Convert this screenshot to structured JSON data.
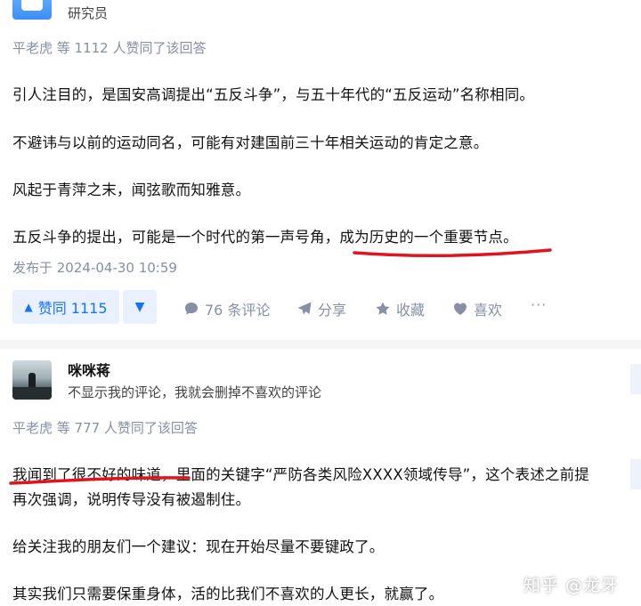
{
  "answer1": {
    "author_headline": "研究员",
    "voters": "平老虎 等 1112 人赞同了该回答",
    "paragraphs": [
      "引人注目的，是国安高调提出“五反斗争”，与五十年代的“五反运动”名称相同。",
      "不避讳与以前的运动同名，可能有对建国前三十年相关运动的肯定之意。",
      "风起于青萍之末，闻弦歌而知雅意。",
      "五反斗争的提出，可能是一个时代的第一声号角，成为历史的一个重要节点。"
    ],
    "published": "发布于 2024-04-30 10:59",
    "actions": {
      "vote_up": "赞同 1115",
      "comments": "76 条评论",
      "share": "分享",
      "collect": "收藏",
      "like": "喜欢",
      "more": "···"
    }
  },
  "answer2": {
    "author_name": "咪咪蒋",
    "author_headline": "不显示我的评论，我就会删掉不喜欢的评论",
    "voters": "平老虎 等 777 人赞同了该回答",
    "paragraph1_line1": "我闻到了很不好的味道，里面的关键字“严防各类风险XXXX领域传导”，这个表述之前提",
    "paragraph1_line2": "再次强调，说明传导没有被遏制住。",
    "paragraph2": "给关注我的朋友们一个建议：现在开始尽量不要键政了。",
    "paragraph3": "其实我们只需要保重身体，活的比我们不喜欢的人更长，就赢了。"
  },
  "watermark": "知乎 @龙牙",
  "colors": {
    "accent": "#1772f6",
    "accent_bg": "#e9f1ff",
    "meta": "#8590a6",
    "annotation_red": "#e0141e"
  },
  "icons": [
    "triangle-up-icon",
    "triangle-down-icon",
    "comment-icon",
    "paper-plane-icon",
    "star-icon",
    "heart-icon",
    "more-icon"
  ]
}
